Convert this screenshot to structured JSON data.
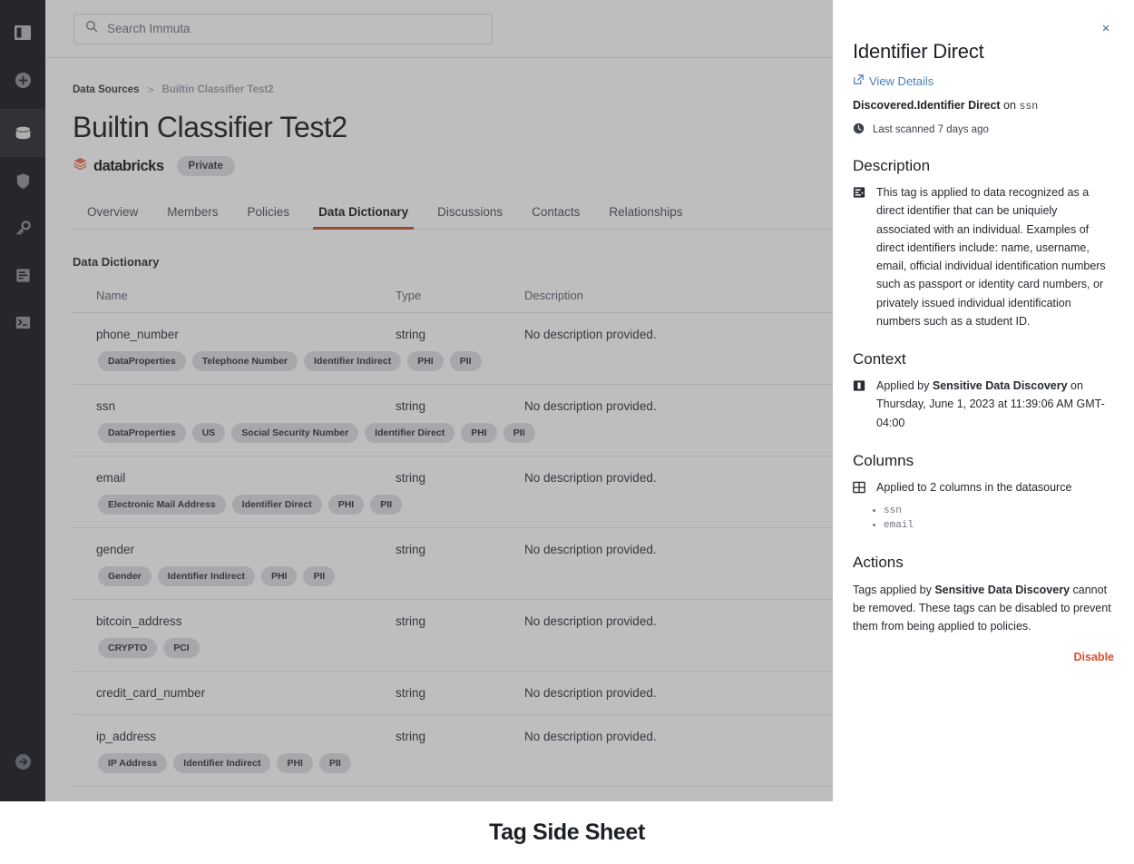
{
  "caption": "Tag Side Sheet",
  "sidebar": {
    "items": [
      {
        "name": "panel-toggle",
        "icon": "panel-icon"
      },
      {
        "name": "add",
        "icon": "plus-circle-icon"
      },
      {
        "name": "data-sources",
        "icon": "database-icon",
        "active": true
      },
      {
        "name": "policies",
        "icon": "shield-icon"
      },
      {
        "name": "secrets",
        "icon": "key-icon"
      },
      {
        "name": "projects",
        "icon": "document-icon"
      },
      {
        "name": "terminal",
        "icon": "terminal-icon"
      }
    ],
    "bottom": {
      "name": "sign-out",
      "icon": "arrow-right-circle-icon"
    }
  },
  "search": {
    "placeholder": "Search Immuta"
  },
  "breadcrumb": {
    "parent": "Data Sources",
    "separator": ">",
    "current": "Builtin Classifier Test2"
  },
  "header": {
    "title": "Builtin Classifier Test2",
    "connector": "databricks",
    "visibility_badge": "Private"
  },
  "tabs": [
    {
      "label": "Overview",
      "active": false
    },
    {
      "label": "Members",
      "active": false
    },
    {
      "label": "Policies",
      "active": false
    },
    {
      "label": "Data Dictionary",
      "active": true
    },
    {
      "label": "Discussions",
      "active": false
    },
    {
      "label": "Contacts",
      "active": false
    },
    {
      "label": "Relationships",
      "active": false
    }
  ],
  "data_dictionary": {
    "section_title": "Data Dictionary",
    "columns": [
      "Name",
      "Type",
      "Description"
    ],
    "rows": [
      {
        "name": "phone_number",
        "type": "string",
        "description": "No description provided.",
        "tags": [
          "DataProperties",
          "Telephone Number",
          "Identifier Indirect",
          "PHI",
          "PII"
        ]
      },
      {
        "name": "ssn",
        "type": "string",
        "description": "No description provided.",
        "tags": [
          "DataProperties",
          "US",
          "Social Security Number",
          "Identifier Direct",
          "PHI",
          "PII"
        ]
      },
      {
        "name": "email",
        "type": "string",
        "description": "No description provided.",
        "tags": [
          "Electronic Mail Address",
          "Identifier Direct",
          "PHI",
          "PII"
        ]
      },
      {
        "name": "gender",
        "type": "string",
        "description": "No description provided.",
        "tags": [
          "Gender",
          "Identifier Indirect",
          "PHI",
          "PII"
        ]
      },
      {
        "name": "bitcoin_address",
        "type": "string",
        "description": "No description provided.",
        "tags": [
          "CRYPTO",
          "PCI"
        ]
      },
      {
        "name": "credit_card_number",
        "type": "string",
        "description": "No description provided.",
        "tags": []
      },
      {
        "name": "ip_address",
        "type": "string",
        "description": "No description provided.",
        "tags": [
          "IP Address",
          "Identifier Indirect",
          "PHI",
          "PII"
        ]
      }
    ]
  },
  "side_sheet": {
    "close_label": "×",
    "title": "Identifier Direct",
    "view_details": "View Details",
    "tag_path_bold": "Discovered.Identifier Direct",
    "tag_path_on": "on",
    "tag_path_column": "ssn",
    "last_scanned": "Last scanned 7 days ago",
    "description_heading": "Description",
    "description_text": "This tag is applied to data recognized as a direct identifier that can be uniquiely associated with an individual. Examples of direct identifiers include: name, username, email, official individual identification numbers such as passport or identity card numbers, or privately issued individual identification numbers such as a student ID.",
    "context_heading": "Context",
    "context_prefix": "Applied by ",
    "context_actor": "Sensitive Data Discovery",
    "context_suffix": " on Thursday, June 1, 2023 at 11:39:06 AM GMT-04:00",
    "columns_heading": "Columns",
    "columns_summary": "Applied to 2 columns in the datasource",
    "columns_list": [
      "ssn",
      "email"
    ],
    "actions_heading": "Actions",
    "actions_prefix": "Tags applied by ",
    "actions_actor": "Sensitive Data Discovery",
    "actions_suffix": " cannot be removed. These tags can be disabled to prevent them from being applied to policies.",
    "disable_label": "Disable"
  },
  "colors": {
    "accent_orange": "#c8512b",
    "disable_red": "#d9502c",
    "link_blue": "#4c7fb5",
    "rail_bg": "#16181d"
  }
}
